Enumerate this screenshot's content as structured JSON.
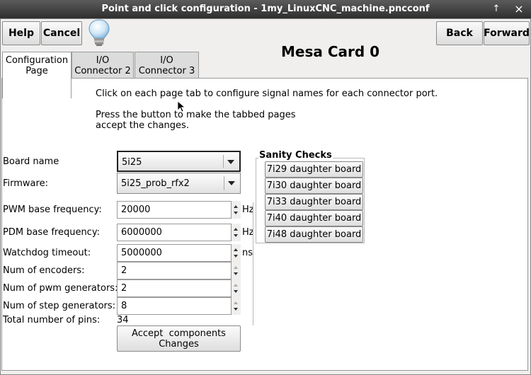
{
  "window": {
    "title": "Point and click configuration - 1my_LinuxCNC_machine.pncconf",
    "maximize_glyph": "↑",
    "close_glyph": "×"
  },
  "toolbar": {
    "help_label": "Help",
    "cancel_label": "Cancel",
    "hint_icon": "lightbulb-icon",
    "back_label": "Back",
    "forward_label": "Forward"
  },
  "heading": "Mesa Card 0",
  "tabs": [
    {
      "line1": "Configuration",
      "line2": "Page",
      "active": true
    },
    {
      "line1": "I/O",
      "line2": "Connector 2",
      "active": false
    },
    {
      "line1": "I/O",
      "line2": "Connector 3",
      "active": false
    }
  ],
  "instructions": {
    "line1": "Click on each page tab to configure signal names for each connector port.",
    "line2": "Press the button to make the tabbed pages",
    "line3": "accept the changes."
  },
  "form": {
    "board_name": {
      "label": "Board name",
      "value": "5i25"
    },
    "firmware": {
      "label": "Firmware:",
      "value": "5i25_prob_rfx2"
    },
    "pwm_base": {
      "label": "PWM base frequency:",
      "value": "20000",
      "unit": "Hz"
    },
    "pdm_base": {
      "label": "PDM base frequency:",
      "value": "6000000",
      "unit": "Hz"
    },
    "watchdog": {
      "label": "Watchdog timeout:",
      "value": "5000000",
      "unit": "ns"
    },
    "encoders": {
      "label": "Num of encoders:",
      "value": "2"
    },
    "pwm_gens": {
      "label": "Num of pwm generators:",
      "value": "2"
    },
    "step_gens": {
      "label": "Num of step generators:",
      "value": "8"
    },
    "total_pins": {
      "label": "Total number of pins:",
      "value": "34"
    }
  },
  "accept_button": {
    "line1": "Accept  components",
    "line2": "Changes"
  },
  "sanity": {
    "title": "Sanity Checks",
    "buttons": [
      "7i29 daughter board",
      "7i30 daughter board",
      "7i33 daughter board",
      "7i40 daughter board",
      "7i48 daughter board"
    ]
  },
  "colors": {
    "titlebar": "#3a3a3a",
    "window_bg": "#f0efee",
    "page_bg": "#ffffff",
    "hint_icon": "#8fc6ee"
  }
}
